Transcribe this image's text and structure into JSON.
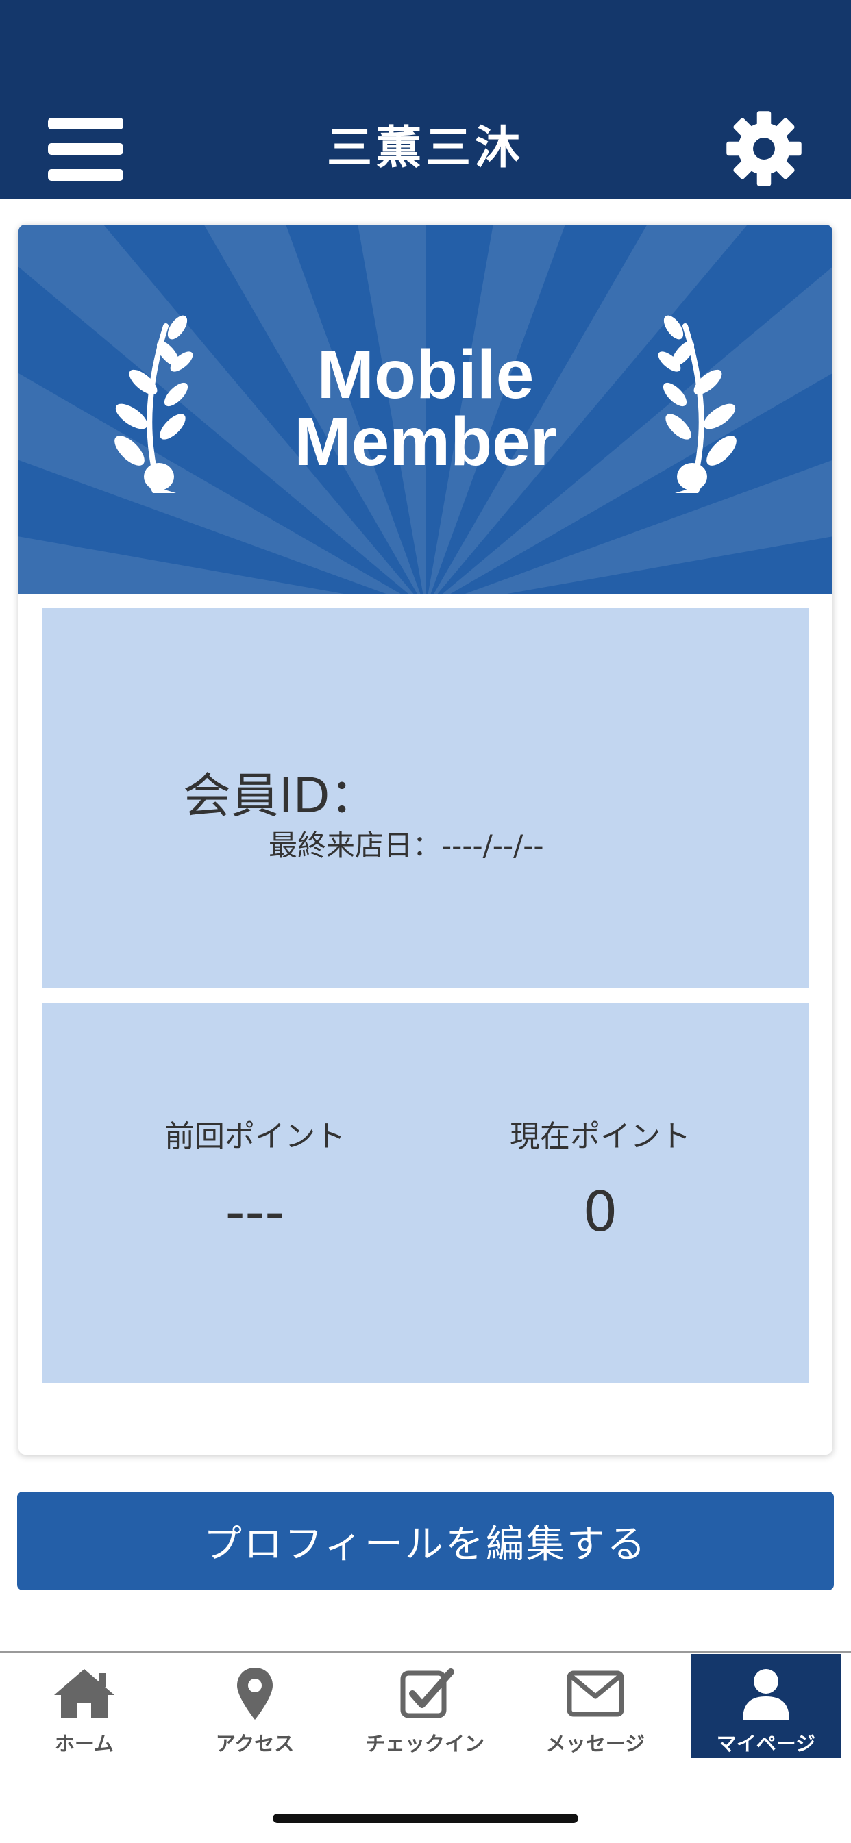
{
  "header": {
    "brand_title": "三薫三沐",
    "menu_icon": "hamburger-menu-icon",
    "settings_icon": "gear-icon",
    "bg_color": "#14376b"
  },
  "banner": {
    "title_line1": "Mobile",
    "title_line2": "Member",
    "laurel_icon": "laurel-branch-icon",
    "bg_color": "#245fa8",
    "ray_color": "#3a6fb0"
  },
  "member": {
    "id_label": "会員ID：",
    "id_value": "",
    "last_visit_label": "最終来店日：",
    "last_visit_value": "----/--/--"
  },
  "points": {
    "previous_label": "前回ポイント",
    "previous_value": "---",
    "current_label": "現在ポイント",
    "current_value": "0"
  },
  "profile_button": {
    "label": "プロフィールを編集する"
  },
  "tabs": [
    {
      "label": "ホーム",
      "icon": "home-icon",
      "active": false
    },
    {
      "label": "アクセス",
      "icon": "map-pin-icon",
      "active": false
    },
    {
      "label": "チェックイン",
      "icon": "checkbox-icon",
      "active": false
    },
    {
      "label": "メッセージ",
      "icon": "envelope-icon",
      "active": false
    },
    {
      "label": "マイページ",
      "icon": "user-icon",
      "active": true
    }
  ],
  "colors": {
    "panel": "#c2d6f0",
    "button": "#245fa8",
    "tab_active": "#14376b"
  }
}
